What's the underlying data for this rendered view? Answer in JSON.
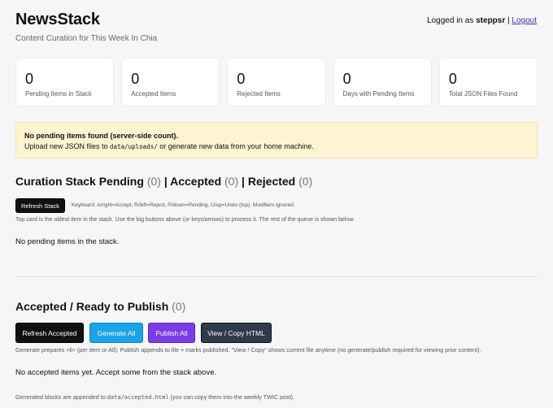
{
  "header": {
    "title": "NewsStack",
    "subtitle": "Content Curation for This Week In Chia",
    "logged_in_prefix": "Logged in as ",
    "username": "steppsr",
    "separator": " | ",
    "logout_label": "Logout"
  },
  "stats": [
    {
      "value": "0",
      "label": "Pending Items in Stack"
    },
    {
      "value": "0",
      "label": "Accepted Items"
    },
    {
      "value": "0",
      "label": "Rejected Items"
    },
    {
      "value": "0",
      "label": "Days with Pending Items"
    },
    {
      "value": "0",
      "label": "Total JSON Files Found"
    }
  ],
  "notice": {
    "title": "No pending items found (server-side count).",
    "text_before": "Upload new JSON files to ",
    "path": "data/uploads/",
    "text_after": " or generate new data from your home machine."
  },
  "stack_section": {
    "title_pending": "Curation Stack Pending",
    "pending_count": "(0)",
    "sep1": " | ",
    "title_accepted": "Accepted",
    "accepted_count": "(0)",
    "sep2": " | ",
    "title_rejected": "Rejected",
    "rejected_count": "(0)",
    "refresh_label": "Refresh Stack",
    "keyboard_hint": "Keyboard: A/right=Accept, R/left=Reject, P/down=Pending, U/up=Undo (top). Modifiers ignored.",
    "note": "Top card is the oldest item in the stack. Use the big buttons above (or keys/arrows) to process it. The rest of the queue is shown below.",
    "empty": "No pending items in the stack."
  },
  "accepted_section": {
    "title": "Accepted / Ready to Publish",
    "count": "(0)",
    "refresh_label": "Refresh Accepted",
    "generate_label": "Generate All",
    "publish_label": "Publish All",
    "view_label": "View / Copy HTML",
    "note": "Generate prepares <li> (per item or All): Publish appends to file + marks published. \"View / Copy\" shows current file anytime (no generate/publish required for viewing prior content).",
    "empty": "No accepted items yet. Accept some from the stack above.",
    "footer_before": "Generated blocks are appended to ",
    "footer_path": "data/accepted.html",
    "footer_after": " (you can copy them into the weekly TWIC post)."
  },
  "colors": {
    "generate": "#1aa3e8",
    "publish": "#7a3ce6",
    "view": "#2f3a4a",
    "notice_bg": "#fdf4d1"
  }
}
